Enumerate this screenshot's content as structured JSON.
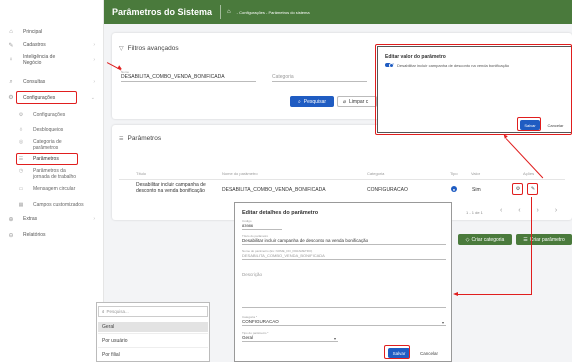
{
  "sidebar": {
    "items": [
      {
        "label": "Principal"
      },
      {
        "label": "Cadastros"
      },
      {
        "label": "Inteligência de Negócio"
      },
      {
        "label": "Consultas"
      },
      {
        "label": "Configurações"
      }
    ],
    "config_subitems": [
      {
        "label": "Configurações"
      },
      {
        "label": "Desbloqueios"
      },
      {
        "label": "Categoria de parâmetros"
      },
      {
        "label": "Parâmetros"
      },
      {
        "label": "Parâmetros da jornada de trabalho"
      },
      {
        "label": "Mensagem circular"
      },
      {
        "label": "Campos customizados"
      }
    ],
    "bottom_items": [
      {
        "label": "Extras"
      },
      {
        "label": "Relatórios"
      }
    ]
  },
  "topbar": {
    "title": "Parâmetros do Sistema",
    "breadcrumb": "- Configurações - Parâmetros do sistema"
  },
  "filters": {
    "title": "Filtros avançados",
    "name_label": "Nome",
    "name_value": "DESABILITA_COMBO_VENDA_BONIFICADA",
    "category_placeholder": "Categoria",
    "search_label": "Pesquisar",
    "clear_label": "Limpar c"
  },
  "params": {
    "title": "Parâmetros",
    "columns": [
      "Título",
      "Nome do parâmetro",
      "Categoria",
      "Tipo",
      "Valor",
      "Ações"
    ],
    "row": {
      "title_line1": "Desabilitar incluir campanha de",
      "title_line2": "desconto na venda bonificação",
      "name": "DESABILITA_COMBO_VENDA_BONIFICADA",
      "category": "CONFIGURACAO",
      "value": "Sim"
    },
    "pagination": "1 - 1 de 1",
    "create_category_label": "Criar categoria",
    "create_param_label": "Criar parâmetro"
  },
  "edit_value_modal": {
    "title": "Editar valor do parâmetro",
    "toggle_label": "Desabilitar incluir campanha de desconto na venda bonificação",
    "save_label": "Salvar",
    "cancel_label": "Cancelar"
  },
  "details_modal": {
    "title": "Editar detalhes do parâmetro",
    "code_label": "Código",
    "code_value": "83986",
    "title_label": "Título do parâmetro",
    "title_value": "Desabilitar incluir campanha de desconto na venda bonificação",
    "name_label": "Nome do parâmetro (Ex: NOME_DO_PARAMETRO)",
    "name_value": "DESABILITA_COMBO_VENDA_BONIFICADA",
    "description_label": "Descrição",
    "category_label": "Categoria *",
    "category_value": "CONFIGURACAO",
    "type_label": "Tipo do parâmetro *",
    "type_value": "Geral",
    "save_label": "Salvar",
    "cancel_label": "Cancelar"
  },
  "type_dropdown": {
    "search_placeholder": "Pesquisa...",
    "options": [
      "Geral",
      "Por usuário",
      "Por filial"
    ]
  },
  "colors": {
    "accent_green": "#4a7a3c",
    "primary_blue": "#1f5cc2",
    "highlight_red": "#e01e1e"
  }
}
